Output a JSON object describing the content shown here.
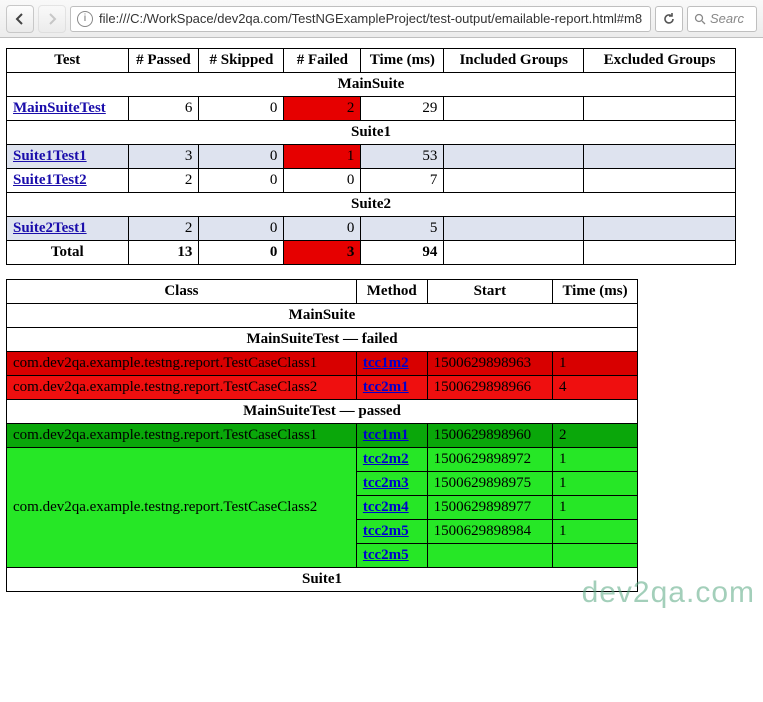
{
  "browser": {
    "url": "file:///C:/WorkSpace/dev2qa.com/TestNGExampleProject/test-output/emailable-report.html#m8",
    "search_placeholder": "Searc"
  },
  "summary": {
    "headers": [
      "Test",
      "# Passed",
      "# Skipped",
      "# Failed",
      "Time (ms)",
      "Included Groups",
      "Excluded Groups"
    ],
    "suites": [
      {
        "name": "MainSuite",
        "rows": [
          {
            "link": "MainSuiteTest",
            "passed": "6",
            "skipped": "0",
            "failed": "2",
            "failed_bad": true,
            "time": "29",
            "inc": "",
            "exc": "",
            "stripe": false
          }
        ]
      },
      {
        "name": "Suite1",
        "rows": [
          {
            "link": "Suite1Test1",
            "passed": "3",
            "skipped": "0",
            "failed": "1",
            "failed_bad": true,
            "time": "53",
            "inc": "",
            "exc": "",
            "stripe": true
          },
          {
            "link": "Suite1Test2",
            "passed": "2",
            "skipped": "0",
            "failed": "0",
            "failed_bad": false,
            "time": "7",
            "inc": "",
            "exc": "",
            "stripe": false
          }
        ]
      },
      {
        "name": "Suite2",
        "rows": [
          {
            "link": "Suite2Test1",
            "passed": "2",
            "skipped": "0",
            "failed": "0",
            "failed_bad": false,
            "time": "5",
            "inc": "",
            "exc": "",
            "stripe": true
          }
        ]
      }
    ],
    "total": {
      "label": "Total",
      "passed": "13",
      "skipped": "0",
      "failed": "3",
      "failed_bad": true,
      "time": "94"
    }
  },
  "details": {
    "headers": [
      "Class",
      "Method",
      "Start",
      "Time (ms)"
    ],
    "sections": [
      {
        "title": "MainSuite",
        "groups": [
          {
            "title": "MainSuiteTest — failed",
            "rows": [
              {
                "class": "com.dev2qa.example.testng.report.TestCaseClass1",
                "method": "tcc1m2",
                "start": "1500629898963",
                "time": "1",
                "style": "row-dark-red"
              },
              {
                "class": "com.dev2qa.example.testng.report.TestCaseClass2",
                "method": "tcc2m1",
                "start": "1500629898966",
                "time": "4",
                "style": "row-red"
              }
            ]
          },
          {
            "title": "MainSuiteTest — passed",
            "rows": [
              {
                "class": "com.dev2qa.example.testng.report.TestCaseClass1",
                "method": "tcc1m1",
                "start": "1500629898960",
                "time": "2",
                "style": "row-dark-green"
              },
              {
                "class": "com.dev2qa.example.testng.report.TestCaseClass2",
                "method": "tcc2m2",
                "start": "1500629898972",
                "time": "1",
                "style": "row-green",
                "rowspan": 5
              },
              {
                "class": "",
                "method": "tcc2m3",
                "start": "1500629898975",
                "time": "1",
                "style": "row-green"
              },
              {
                "class": "",
                "method": "tcc2m4",
                "start": "1500629898977",
                "time": "1",
                "style": "row-green"
              },
              {
                "class": "",
                "method": "tcc2m5",
                "start": "1500629898984",
                "time": "1",
                "style": "row-green"
              },
              {
                "class": "",
                "method": "tcc2m5",
                "start": "",
                "time": "",
                "style": "row-green"
              }
            ]
          }
        ]
      },
      {
        "title": "Suite1",
        "groups": []
      }
    ]
  },
  "watermark": "dev2qa.com"
}
